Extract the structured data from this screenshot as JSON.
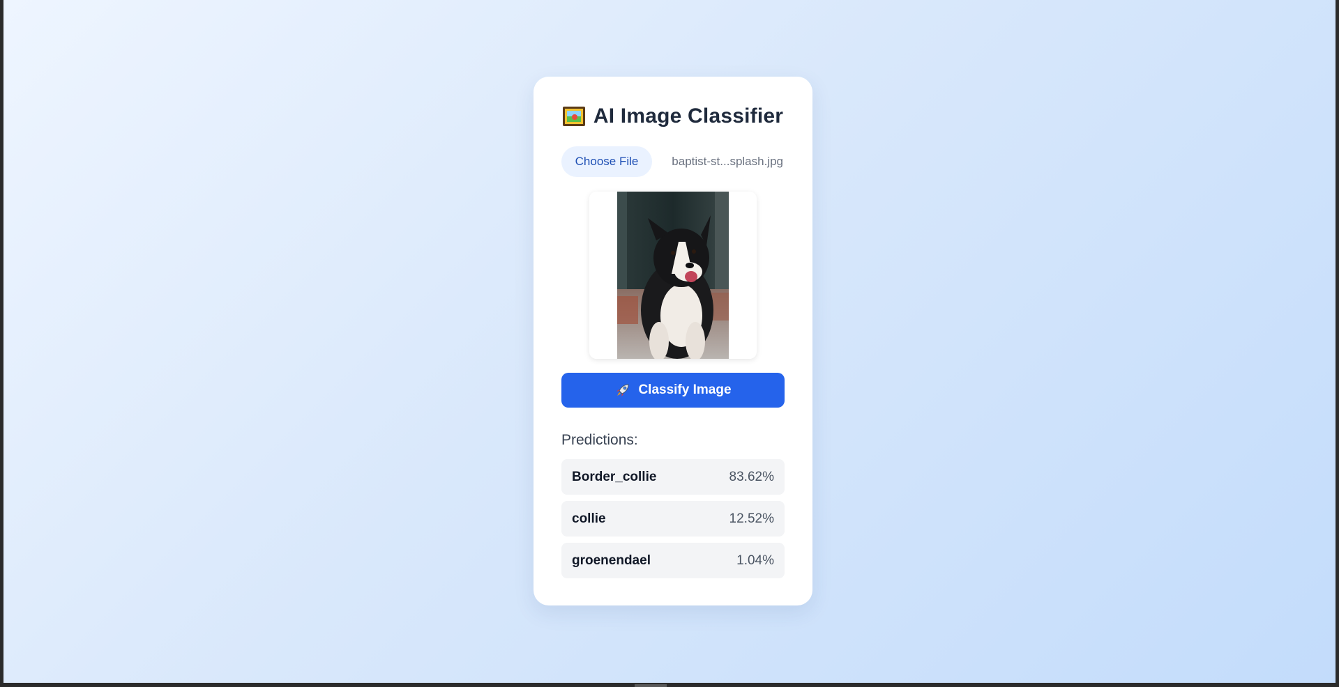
{
  "app": {
    "title": "AI Image Classifier",
    "title_icon": "framed-picture-icon"
  },
  "file_input": {
    "button_label": "Choose File",
    "file_name": "baptist-st...splash.jpg"
  },
  "preview": {
    "image_description": "dog-photo",
    "icon": "dog-photo-icon"
  },
  "actions": {
    "classify_label": "Classify Image",
    "classify_icon": "rocket-icon"
  },
  "predictions": {
    "heading": "Predictions:",
    "items": [
      {
        "label": "Border_collie",
        "score": "83.62%"
      },
      {
        "label": "collie",
        "score": "12.52%"
      },
      {
        "label": "groenendael",
        "score": "1.04%"
      }
    ]
  },
  "colors": {
    "accent": "#2563eb",
    "choose_button_bg": "#eaf2ff",
    "choose_button_text": "#1e4fb4",
    "prediction_row_bg": "#f3f4f6",
    "background_start": "#eef5ff",
    "background_end": "#c3dcfb"
  }
}
